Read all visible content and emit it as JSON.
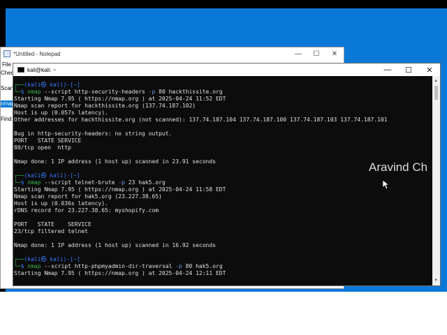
{
  "notepad": {
    "title": "*Untitled - Notepad",
    "menu_first": "File",
    "fragments": [
      "Chec",
      "Scan",
      "nmap",
      "Find"
    ],
    "controls": {
      "minimize": "—",
      "maximize": "☐",
      "close": "✕"
    }
  },
  "terminal": {
    "title": "kali@kali: ~",
    "controls": {
      "minimize": "—",
      "maximize": "☐",
      "close": "✕"
    },
    "lines": [
      {
        "kind": "prompt_top",
        "host": "(kali㉿ kali)-[~]"
      },
      {
        "kind": "prompt_cmd",
        "cmd": "nmap",
        "args": " --script http-security-headers ",
        "opt": "-p",
        "rest": " 80 hackthissite.org"
      },
      {
        "kind": "text",
        "text": "Starting Nmap 7.95 ( https://nmap.org ) at 2025-04-24 11:52 EDT"
      },
      {
        "kind": "text",
        "text": "Nmap scan report for hackthissite.org (137.74.187.102)"
      },
      {
        "kind": "text",
        "text": "Host is up (0.057s latency)."
      },
      {
        "kind": "text",
        "text": "Other addresses for hackthissite.org (not scanned): 137.74.187.104 137.74.187.100 137.74.187.103 137.74.187.101"
      },
      {
        "kind": "text",
        "text": ""
      },
      {
        "kind": "text",
        "text": "Bug in http-security-headers: no string output."
      },
      {
        "kind": "text",
        "text": "PORT   STATE SERVICE"
      },
      {
        "kind": "text",
        "text": "80/tcp open  http"
      },
      {
        "kind": "text",
        "text": ""
      },
      {
        "kind": "text",
        "text": "Nmap done: 1 IP address (1 host up) scanned in 23.91 seconds"
      },
      {
        "kind": "text",
        "text": ""
      },
      {
        "kind": "prompt_top",
        "host": "(kali㉿ kali)-[~]"
      },
      {
        "kind": "prompt_cmd",
        "cmd": "nmap",
        "args": " --script telnet-brute ",
        "opt": "-p",
        "rest": " 23 hak5.org"
      },
      {
        "kind": "text",
        "text": "Starting Nmap 7.95 ( https://nmap.org ) at 2025-04-24 11:58 EDT"
      },
      {
        "kind": "text",
        "text": "Nmap scan report for hak5.org (23.227.38.65)"
      },
      {
        "kind": "text",
        "text": "Host is up (0.036s latency)."
      },
      {
        "kind": "text",
        "text": "rDNS record for 23.227.38.65: myshopify.com"
      },
      {
        "kind": "text",
        "text": ""
      },
      {
        "kind": "text",
        "text": "PORT   STATE    SERVICE"
      },
      {
        "kind": "text",
        "text": "23/tcp filtered telnet"
      },
      {
        "kind": "text",
        "text": ""
      },
      {
        "kind": "text",
        "text": "Nmap done: 1 IP address (1 host up) scanned in 16.92 seconds"
      },
      {
        "kind": "text",
        "text": ""
      },
      {
        "kind": "prompt_top",
        "host": "(kali㉿ kali)-[~]"
      },
      {
        "kind": "prompt_cmd",
        "cmd": "nmap",
        "args": " --script http-phpmyadmin-dir-traversal ",
        "opt": "-p",
        "rest": " 80 hak5.org"
      },
      {
        "kind": "text",
        "text": "Starting Nmap 7.95 ( https://nmap.org ) at 2025-04-24 12:11 EDT"
      }
    ]
  },
  "watermark": "Aravind Ch",
  "colors": {
    "desktop": "#0a78d7",
    "terminal_bg": "#0c0c0c",
    "prompt_green": "#3bb54a",
    "prompt_blue": "#3b78ff"
  }
}
